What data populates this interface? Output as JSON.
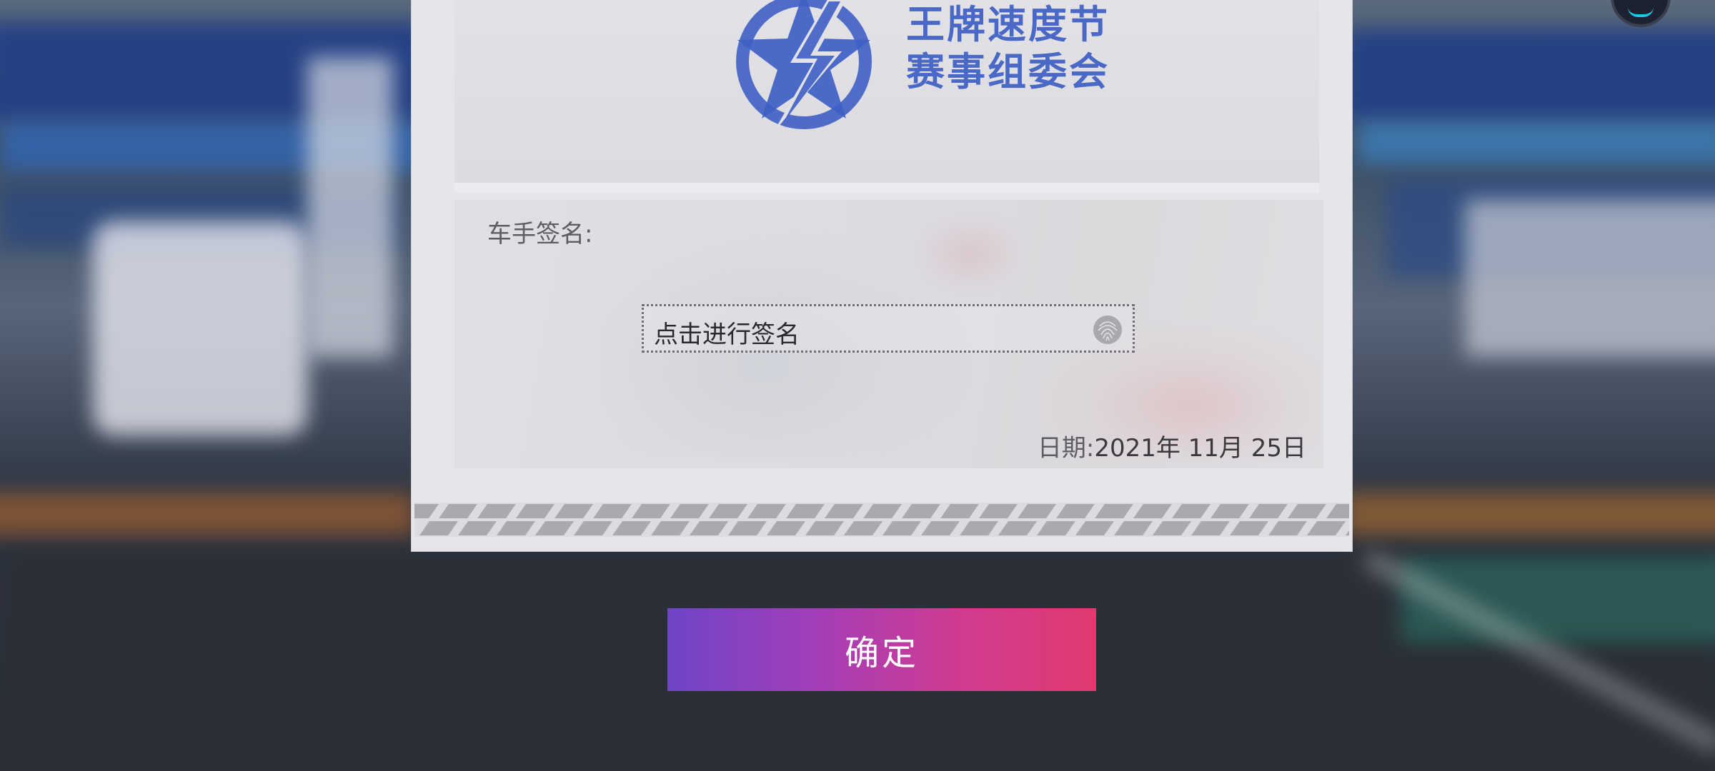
{
  "stamp": {
    "line1": "王牌速度节",
    "line2": "赛事组委会",
    "color": "#3e5fc4"
  },
  "signature": {
    "label": "车手签名:",
    "prompt": "点击进行签名",
    "icon": "fingerprint-icon"
  },
  "date": {
    "label": "日期:",
    "value": "2021年 11月 25日"
  },
  "confirm_label": "确定",
  "colors": {
    "button_gradient_start": "#6e45c8",
    "button_gradient_end": "#e03a70",
    "accent_ring": "#22c3e6"
  }
}
